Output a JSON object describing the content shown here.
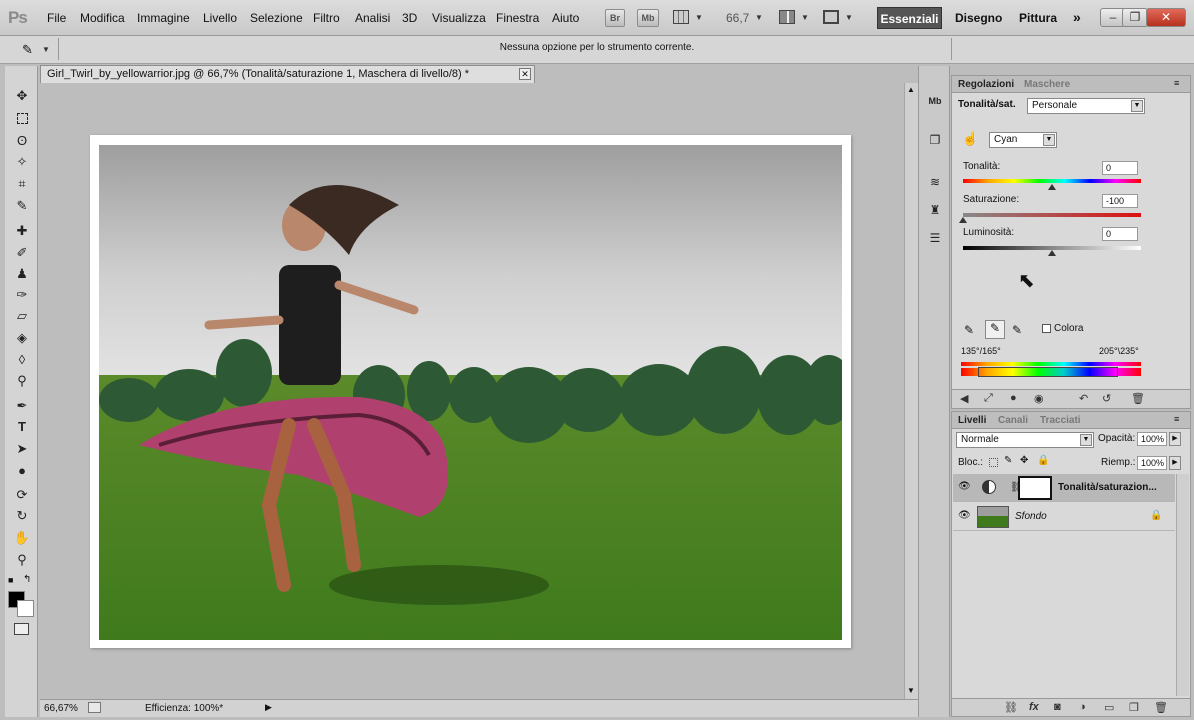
{
  "app": {
    "logo": "Ps"
  },
  "menu": [
    "File",
    "Modifica",
    "Immagine",
    "Livello",
    "Selezione",
    "Filtro",
    "Analisi",
    "3D",
    "Visualizza",
    "Finestra",
    "Aiuto"
  ],
  "appbar": {
    "bridge": "Br",
    "minibridge": "Mb",
    "zoom": "66,7"
  },
  "workspaces": {
    "active": "Essenziali",
    "items": [
      "Disegno",
      "Pittura"
    ],
    "more": "»"
  },
  "window_buttons": {
    "minimize": "–",
    "restore": "❐",
    "close": "✕"
  },
  "options_bar": {
    "message": "Nessuna opzione per lo strumento corrente."
  },
  "document": {
    "tab_title": "Girl_Twirl_by_yellowarrior.jpg @ 66,7% (Tonalità/saturazione 1, Maschera di livello/8) *"
  },
  "status": {
    "zoom": "66,67%",
    "efficiency": "Efficienza: 100%*"
  },
  "adjustments": {
    "tabs": [
      "Regolazioni",
      "Maschere"
    ],
    "title": "Tonalità/sat.",
    "preset": "Personale",
    "channel": "Cyan",
    "hue_label": "Tonalità:",
    "hue_value": "0",
    "sat_label": "Saturazione:",
    "sat_value": "-100",
    "light_label": "Luminosità:",
    "light_value": "0",
    "colorize_label": "Colora",
    "range_left": "135°/165°",
    "range_right": "205°\\235°"
  },
  "layers": {
    "tabs": [
      "Livelli",
      "Canali",
      "Tracciati"
    ],
    "blend_mode": "Normale",
    "opacity_label": "Opacità:",
    "opacity": "100%",
    "lock_label": "Bloc.:",
    "fill_label": "Riemp.:",
    "fill": "100%",
    "items": [
      {
        "name": "Tonalità/saturazion...",
        "type": "adjustment"
      },
      {
        "name": "Sfondo",
        "type": "background"
      }
    ]
  },
  "colors": {
    "accent_dark": "#555555",
    "panel_bg": "#d9d9d9"
  }
}
